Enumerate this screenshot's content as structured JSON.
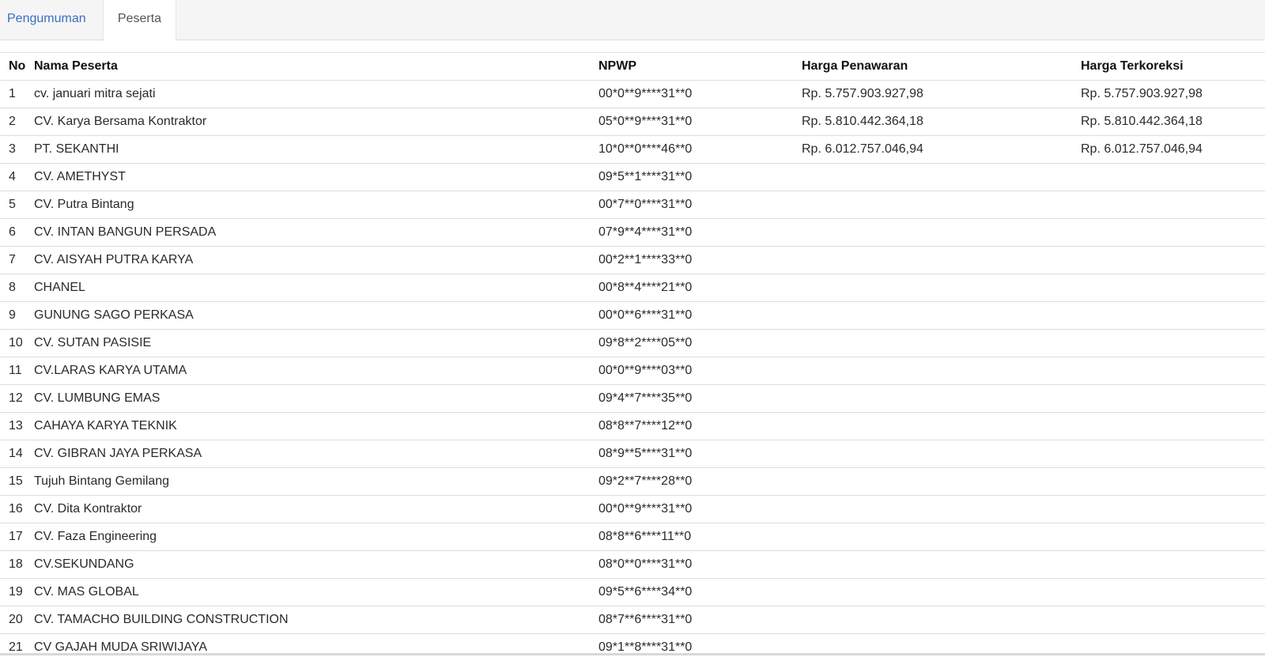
{
  "tabs": [
    {
      "label": "Pengumuman",
      "active": false
    },
    {
      "label": "Peserta",
      "active": true
    }
  ],
  "table": {
    "headers": {
      "no": "No",
      "name": "Nama Peserta",
      "npwp": "NPWP",
      "harga": "Harga Penawaran",
      "koreksi": "Harga Terkoreksi"
    },
    "rows": [
      {
        "no": "1",
        "name": "cv. januari mitra sejati",
        "npwp": "00*0**9****31**0",
        "harga": "Rp. 5.757.903.927,98",
        "koreksi": "Rp. 5.757.903.927,98"
      },
      {
        "no": "2",
        "name": "CV. Karya Bersama Kontraktor",
        "npwp": "05*0**9****31**0",
        "harga": "Rp. 5.810.442.364,18",
        "koreksi": "Rp. 5.810.442.364,18"
      },
      {
        "no": "3",
        "name": "PT. SEKANTHI",
        "npwp": "10*0**0****46**0",
        "harga": "Rp. 6.012.757.046,94",
        "koreksi": "Rp. 6.012.757.046,94"
      },
      {
        "no": "4",
        "name": "CV. AMETHYST",
        "npwp": "09*5**1****31**0",
        "harga": "",
        "koreksi": ""
      },
      {
        "no": "5",
        "name": "CV. Putra Bintang",
        "npwp": "00*7**0****31**0",
        "harga": "",
        "koreksi": ""
      },
      {
        "no": "6",
        "name": "CV. INTAN BANGUN PERSADA",
        "npwp": "07*9**4****31**0",
        "harga": "",
        "koreksi": ""
      },
      {
        "no": "7",
        "name": "CV. AISYAH PUTRA KARYA",
        "npwp": "00*2**1****33**0",
        "harga": "",
        "koreksi": ""
      },
      {
        "no": "8",
        "name": "CHANEL",
        "npwp": "00*8**4****21**0",
        "harga": "",
        "koreksi": ""
      },
      {
        "no": "9",
        "name": "GUNUNG SAGO PERKASA",
        "npwp": "00*0**6****31**0",
        "harga": "",
        "koreksi": ""
      },
      {
        "no": "10",
        "name": "CV. SUTAN PASISIE",
        "npwp": "09*8**2****05**0",
        "harga": "",
        "koreksi": ""
      },
      {
        "no": "11",
        "name": "CV.LARAS KARYA UTAMA",
        "npwp": "00*0**9****03**0",
        "harga": "",
        "koreksi": ""
      },
      {
        "no": "12",
        "name": "CV. LUMBUNG EMAS",
        "npwp": "09*4**7****35**0",
        "harga": "",
        "koreksi": ""
      },
      {
        "no": "13",
        "name": "CAHAYA KARYA TEKNIK",
        "npwp": "08*8**7****12**0",
        "harga": "",
        "koreksi": ""
      },
      {
        "no": "14",
        "name": "CV. GIBRAN JAYA PERKASA",
        "npwp": "08*9**5****31**0",
        "harga": "",
        "koreksi": ""
      },
      {
        "no": "15",
        "name": "Tujuh Bintang Gemilang",
        "npwp": "09*2**7****28**0",
        "harga": "",
        "koreksi": ""
      },
      {
        "no": "16",
        "name": "CV. Dita Kontraktor",
        "npwp": "00*0**9****31**0",
        "harga": "",
        "koreksi": ""
      },
      {
        "no": "17",
        "name": "CV. Faza Engineering",
        "npwp": "08*8**6****11**0",
        "harga": "",
        "koreksi": ""
      },
      {
        "no": "18",
        "name": "CV.SEKUNDANG",
        "npwp": "08*0**0****31**0",
        "harga": "",
        "koreksi": ""
      },
      {
        "no": "19",
        "name": "CV. MAS GLOBAL",
        "npwp": "09*5**6****34**0",
        "harga": "",
        "koreksi": ""
      },
      {
        "no": "20",
        "name": "CV. TAMACHO BUILDING CONSTRUCTION",
        "npwp": "08*7**6****31**0",
        "harga": "",
        "koreksi": ""
      },
      {
        "no": "21",
        "name": "CV GAJAH MUDA SRIWIJAYA",
        "npwp": "09*1**8****31**0",
        "harga": "",
        "koreksi": ""
      }
    ]
  }
}
